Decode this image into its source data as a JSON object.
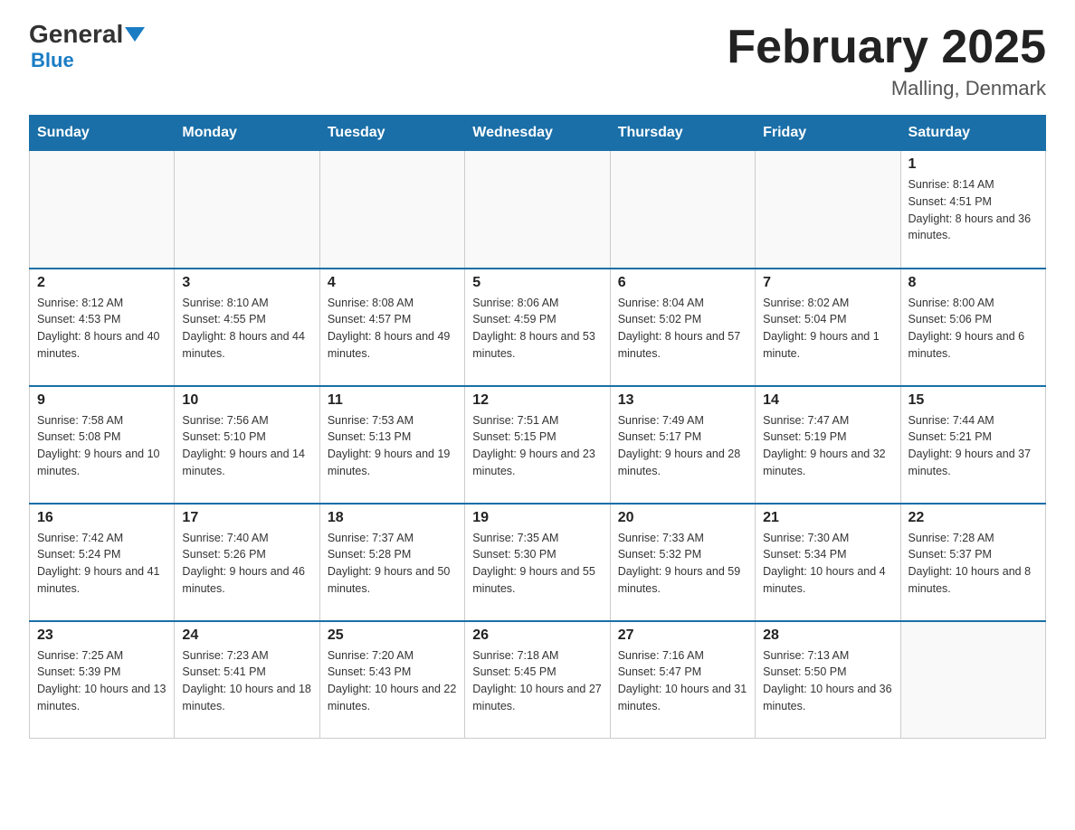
{
  "header": {
    "logo": {
      "general": "General",
      "blue": "Blue",
      "triangle": "▼"
    },
    "title": "February 2025",
    "location": "Malling, Denmark"
  },
  "weekdays": [
    "Sunday",
    "Monday",
    "Tuesday",
    "Wednesday",
    "Thursday",
    "Friday",
    "Saturday"
  ],
  "weeks": [
    [
      {
        "day": "",
        "info": ""
      },
      {
        "day": "",
        "info": ""
      },
      {
        "day": "",
        "info": ""
      },
      {
        "day": "",
        "info": ""
      },
      {
        "day": "",
        "info": ""
      },
      {
        "day": "",
        "info": ""
      },
      {
        "day": "1",
        "info": "Sunrise: 8:14 AM\nSunset: 4:51 PM\nDaylight: 8 hours and 36 minutes."
      }
    ],
    [
      {
        "day": "2",
        "info": "Sunrise: 8:12 AM\nSunset: 4:53 PM\nDaylight: 8 hours and 40 minutes."
      },
      {
        "day": "3",
        "info": "Sunrise: 8:10 AM\nSunset: 4:55 PM\nDaylight: 8 hours and 44 minutes."
      },
      {
        "day": "4",
        "info": "Sunrise: 8:08 AM\nSunset: 4:57 PM\nDaylight: 8 hours and 49 minutes."
      },
      {
        "day": "5",
        "info": "Sunrise: 8:06 AM\nSunset: 4:59 PM\nDaylight: 8 hours and 53 minutes."
      },
      {
        "day": "6",
        "info": "Sunrise: 8:04 AM\nSunset: 5:02 PM\nDaylight: 8 hours and 57 minutes."
      },
      {
        "day": "7",
        "info": "Sunrise: 8:02 AM\nSunset: 5:04 PM\nDaylight: 9 hours and 1 minute."
      },
      {
        "day": "8",
        "info": "Sunrise: 8:00 AM\nSunset: 5:06 PM\nDaylight: 9 hours and 6 minutes."
      }
    ],
    [
      {
        "day": "9",
        "info": "Sunrise: 7:58 AM\nSunset: 5:08 PM\nDaylight: 9 hours and 10 minutes."
      },
      {
        "day": "10",
        "info": "Sunrise: 7:56 AM\nSunset: 5:10 PM\nDaylight: 9 hours and 14 minutes."
      },
      {
        "day": "11",
        "info": "Sunrise: 7:53 AM\nSunset: 5:13 PM\nDaylight: 9 hours and 19 minutes."
      },
      {
        "day": "12",
        "info": "Sunrise: 7:51 AM\nSunset: 5:15 PM\nDaylight: 9 hours and 23 minutes."
      },
      {
        "day": "13",
        "info": "Sunrise: 7:49 AM\nSunset: 5:17 PM\nDaylight: 9 hours and 28 minutes."
      },
      {
        "day": "14",
        "info": "Sunrise: 7:47 AM\nSunset: 5:19 PM\nDaylight: 9 hours and 32 minutes."
      },
      {
        "day": "15",
        "info": "Sunrise: 7:44 AM\nSunset: 5:21 PM\nDaylight: 9 hours and 37 minutes."
      }
    ],
    [
      {
        "day": "16",
        "info": "Sunrise: 7:42 AM\nSunset: 5:24 PM\nDaylight: 9 hours and 41 minutes."
      },
      {
        "day": "17",
        "info": "Sunrise: 7:40 AM\nSunset: 5:26 PM\nDaylight: 9 hours and 46 minutes."
      },
      {
        "day": "18",
        "info": "Sunrise: 7:37 AM\nSunset: 5:28 PM\nDaylight: 9 hours and 50 minutes."
      },
      {
        "day": "19",
        "info": "Sunrise: 7:35 AM\nSunset: 5:30 PM\nDaylight: 9 hours and 55 minutes."
      },
      {
        "day": "20",
        "info": "Sunrise: 7:33 AM\nSunset: 5:32 PM\nDaylight: 9 hours and 59 minutes."
      },
      {
        "day": "21",
        "info": "Sunrise: 7:30 AM\nSunset: 5:34 PM\nDaylight: 10 hours and 4 minutes."
      },
      {
        "day": "22",
        "info": "Sunrise: 7:28 AM\nSunset: 5:37 PM\nDaylight: 10 hours and 8 minutes."
      }
    ],
    [
      {
        "day": "23",
        "info": "Sunrise: 7:25 AM\nSunset: 5:39 PM\nDaylight: 10 hours and 13 minutes."
      },
      {
        "day": "24",
        "info": "Sunrise: 7:23 AM\nSunset: 5:41 PM\nDaylight: 10 hours and 18 minutes."
      },
      {
        "day": "25",
        "info": "Sunrise: 7:20 AM\nSunset: 5:43 PM\nDaylight: 10 hours and 22 minutes."
      },
      {
        "day": "26",
        "info": "Sunrise: 7:18 AM\nSunset: 5:45 PM\nDaylight: 10 hours and 27 minutes."
      },
      {
        "day": "27",
        "info": "Sunrise: 7:16 AM\nSunset: 5:47 PM\nDaylight: 10 hours and 31 minutes."
      },
      {
        "day": "28",
        "info": "Sunrise: 7:13 AM\nSunset: 5:50 PM\nDaylight: 10 hours and 36 minutes."
      },
      {
        "day": "",
        "info": ""
      }
    ]
  ]
}
